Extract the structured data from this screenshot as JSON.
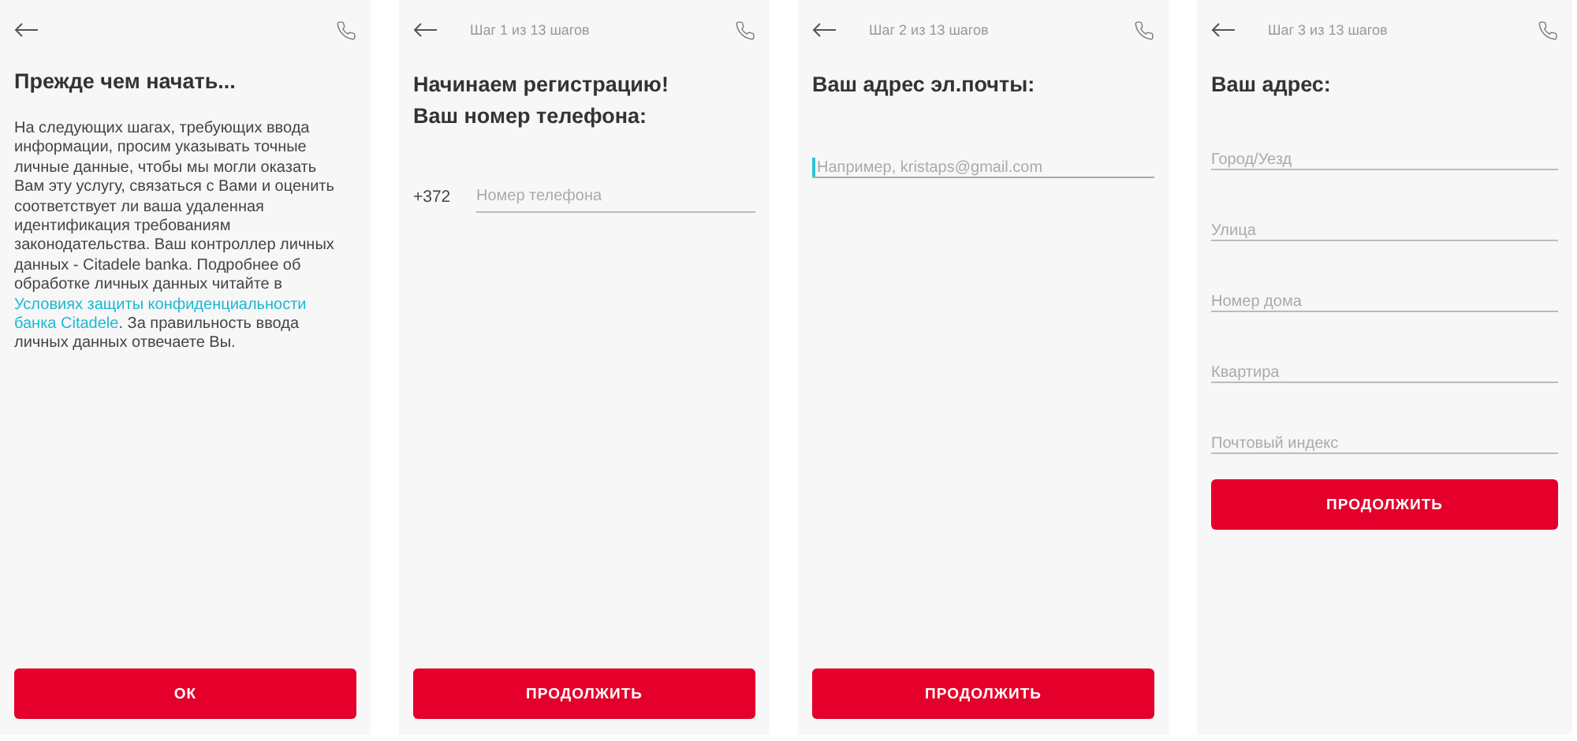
{
  "screens": [
    {
      "kind": "intro",
      "title": [
        "Прежде чем начать..."
      ],
      "paragraph": {
        "before": "На следующих шагах, требующих ввода информации, просим указывать точные личные данные, чтобы мы могли оказать Вам эту услугу, связаться с Вами и оценить соответствует ли ваша удаленная идентификация требованиям законодательства. Ваш контроллер личных данных - Citadele banka. Подробнее об обработке личных данных читайте в",
        "link_lines": [
          "Условиях защиты конфиденциальности",
          "банка Citadele"
        ],
        "after": ". За правильность ввода личных данных отвечаете Вы."
      },
      "button": "ОК"
    },
    {
      "kind": "phone",
      "step": "Шаг 1 из 13 шагов",
      "title": [
        "Начинаем регистрацию!",
        "Ваш номер телефона:"
      ],
      "prefix": "+372",
      "fields": [
        {
          "placeholder": "Номер телефона",
          "focused": false
        }
      ],
      "button": "ПРОДОЛЖИТЬ"
    },
    {
      "kind": "email",
      "step": "Шаг 2 из 13 шагов",
      "title": [
        "Ваш адрес эл.почты:"
      ],
      "fields": [
        {
          "placeholder": "Например, kristaps@gmail.com",
          "focused": true
        }
      ],
      "button": "ПРОДОЛЖИТЬ"
    },
    {
      "kind": "address",
      "step": "Шаг 3 из 13 шагов",
      "title": [
        "Ваш адрес:"
      ],
      "fields": [
        {
          "placeholder": "Город/Уезд",
          "focused": false
        },
        {
          "placeholder": "Улица",
          "focused": false
        },
        {
          "placeholder": "Номер дома",
          "focused": false
        },
        {
          "placeholder": "Квартира",
          "focused": false
        },
        {
          "placeholder": "Почтовый индекс",
          "focused": false
        }
      ],
      "button": "ПРОДОЛЖИТЬ"
    }
  ]
}
